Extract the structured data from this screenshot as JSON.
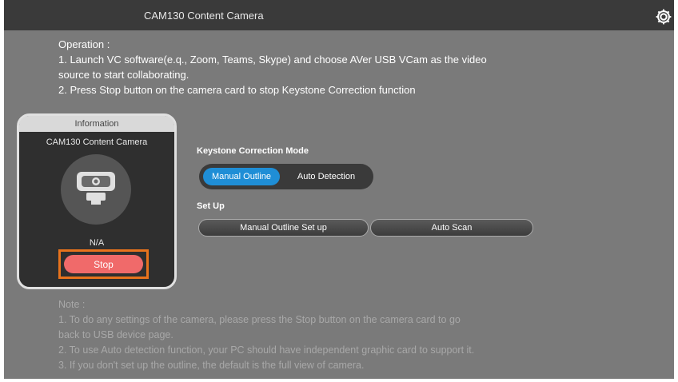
{
  "window": {
    "title": "CAM130 Content Camera",
    "settings_icon": "gear-icon"
  },
  "operation": {
    "lines": [
      "Operation :",
      "1. Launch VC software(e.q., Zoom, Teams, Skype) and choose AVer USB VCam as the video",
      "source to start collaborating.",
      "2. Press Stop button on the camera card to stop Keystone Correction function"
    ]
  },
  "card": {
    "tab_label": "Information",
    "device_name": "CAM130 Content Camera",
    "icon": "webcam-icon",
    "status": "N/A",
    "stop_label": "Stop",
    "stop_color": "#f06a6a",
    "highlight_color": "#e8731c"
  },
  "keystone": {
    "label": "Keystone Correction Mode",
    "modes": [
      "Manual Outline",
      "Auto Detection"
    ],
    "selected": "Manual Outline",
    "accent": "#1f8ed6"
  },
  "setup": {
    "label": "Set Up",
    "buttons": [
      "Manual Outline Set up",
      "Auto Scan"
    ]
  },
  "note": {
    "lines": [
      "Note :",
      "1. To do any settings of the camera, please press the Stop button on the camera card to go",
      "back to USB device page.",
      "2. To use Auto detection function, your PC should have independent graphic card to support it.",
      "3. If you don't set up the outline, the default is the full view of camera."
    ]
  }
}
